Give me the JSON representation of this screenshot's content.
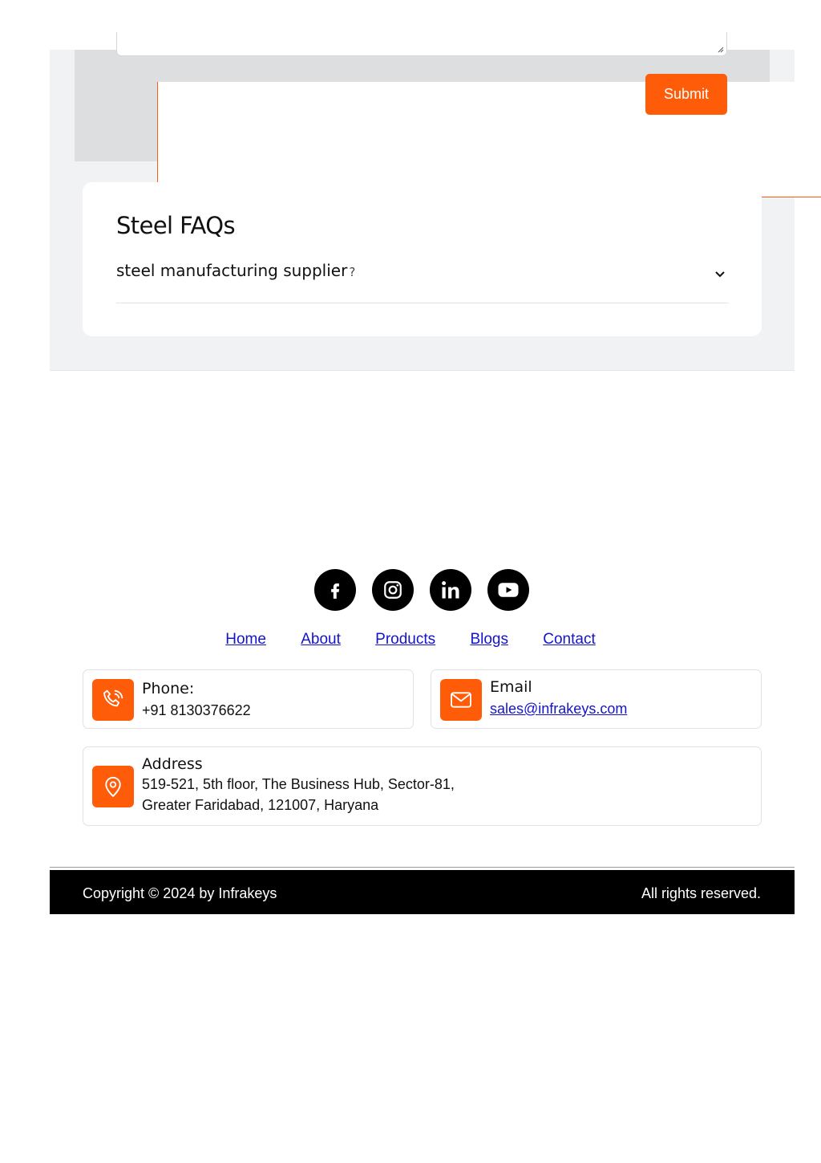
{
  "form": {
    "submit_label": "Submit"
  },
  "faq": {
    "title": "Steel FAQs",
    "items": [
      {
        "question": "steel manufacturing supplier",
        "question_mark": "?"
      }
    ]
  },
  "social": [
    "facebook-icon",
    "instagram-icon",
    "linkedin-icon",
    "youtube-icon"
  ],
  "nav": {
    "home": "Home",
    "about": "About",
    "products": "Products",
    "blogs": "Blogs",
    "contact": "Contact"
  },
  "contact": {
    "phone_label": "Phone:",
    "phone_value": "+91 8130376622",
    "email_label": "Email",
    "email_value": "sales@infrakeys.com",
    "address_label": "Address",
    "address_line1": "519-521, 5th floor, The Business Hub, Sector-81,",
    "address_line2": "Greater Faridabad, 121007, Haryana"
  },
  "footer": {
    "copyright": "Copyright © 2024 by Infrakeys",
    "rights": "All rights reserved."
  },
  "colors": {
    "accent": "#ff5c0a",
    "link": "#1414c8",
    "footer_bg": "#000000"
  }
}
